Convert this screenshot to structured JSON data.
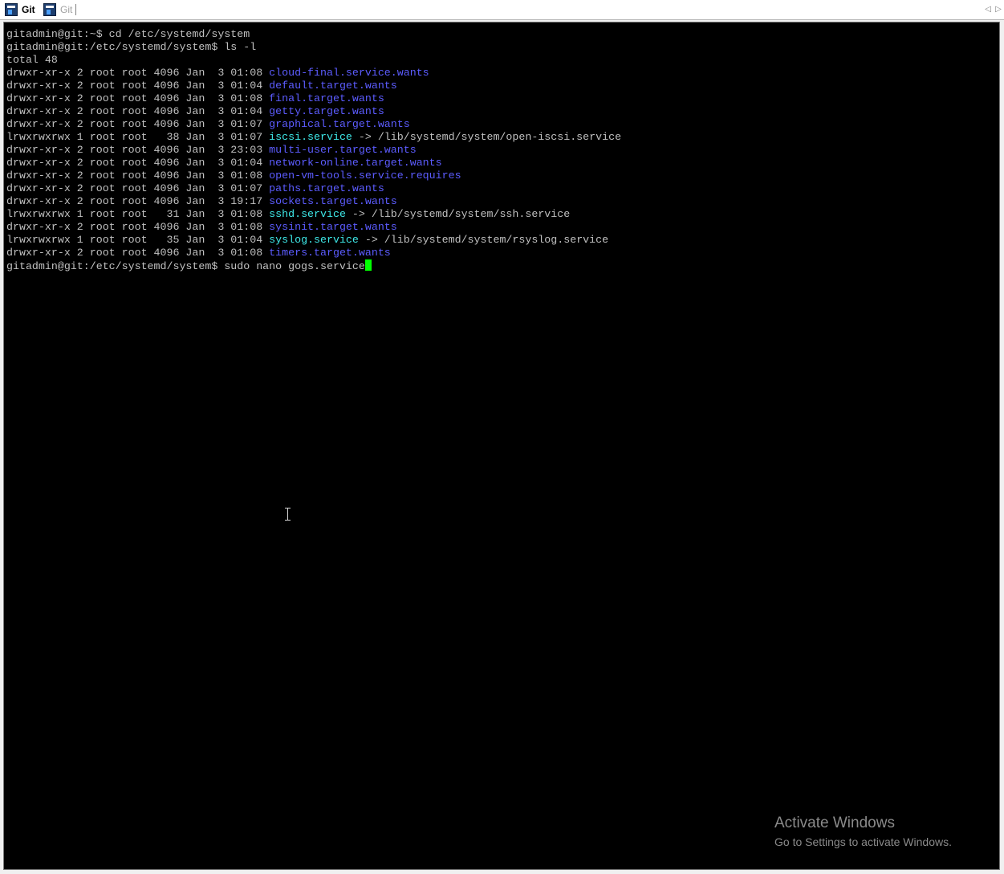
{
  "tabs": [
    {
      "label": "Git",
      "active": true
    },
    {
      "label": "Git",
      "active": false
    }
  ],
  "terminal": {
    "lines": [
      [
        {
          "t": "gitadmin@git:~$ cd /etc/systemd/system",
          "c": "plain"
        }
      ],
      [
        {
          "t": "gitadmin@git:/etc/systemd/system$ ls -l",
          "c": "plain"
        }
      ],
      [
        {
          "t": "total 48",
          "c": "plain"
        }
      ],
      [
        {
          "t": "drwxr-xr-x 2 root root 4096 Jan  3 01:08 ",
          "c": "plain"
        },
        {
          "t": "cloud-final.service.wants",
          "c": "dir"
        }
      ],
      [
        {
          "t": "drwxr-xr-x 2 root root 4096 Jan  3 01:04 ",
          "c": "plain"
        },
        {
          "t": "default.target.wants",
          "c": "dir"
        }
      ],
      [
        {
          "t": "drwxr-xr-x 2 root root 4096 Jan  3 01:08 ",
          "c": "plain"
        },
        {
          "t": "final.target.wants",
          "c": "dir"
        }
      ],
      [
        {
          "t": "drwxr-xr-x 2 root root 4096 Jan  3 01:04 ",
          "c": "plain"
        },
        {
          "t": "getty.target.wants",
          "c": "dir"
        }
      ],
      [
        {
          "t": "drwxr-xr-x 2 root root 4096 Jan  3 01:07 ",
          "c": "plain"
        },
        {
          "t": "graphical.target.wants",
          "c": "dir"
        }
      ],
      [
        {
          "t": "lrwxrwxrwx 1 root root   38 Jan  3 01:07 ",
          "c": "plain"
        },
        {
          "t": "iscsi.service",
          "c": "lnk"
        },
        {
          "t": " -> /lib/systemd/system/open-iscsi.service",
          "c": "plain"
        }
      ],
      [
        {
          "t": "drwxr-xr-x 2 root root 4096 Jan  3 23:03 ",
          "c": "plain"
        },
        {
          "t": "multi-user.target.wants",
          "c": "dir"
        }
      ],
      [
        {
          "t": "drwxr-xr-x 2 root root 4096 Jan  3 01:04 ",
          "c": "plain"
        },
        {
          "t": "network-online.target.wants",
          "c": "dir"
        }
      ],
      [
        {
          "t": "drwxr-xr-x 2 root root 4096 Jan  3 01:08 ",
          "c": "plain"
        },
        {
          "t": "open-vm-tools.service.requires",
          "c": "dir"
        }
      ],
      [
        {
          "t": "drwxr-xr-x 2 root root 4096 Jan  3 01:07 ",
          "c": "plain"
        },
        {
          "t": "paths.target.wants",
          "c": "dir"
        }
      ],
      [
        {
          "t": "drwxr-xr-x 2 root root 4096 Jan  3 19:17 ",
          "c": "plain"
        },
        {
          "t": "sockets.target.wants",
          "c": "dir"
        }
      ],
      [
        {
          "t": "lrwxrwxrwx 1 root root   31 Jan  3 01:08 ",
          "c": "plain"
        },
        {
          "t": "sshd.service",
          "c": "lnk"
        },
        {
          "t": " -> /lib/systemd/system/ssh.service",
          "c": "plain"
        }
      ],
      [
        {
          "t": "drwxr-xr-x 2 root root 4096 Jan  3 01:08 ",
          "c": "plain"
        },
        {
          "t": "sysinit.target.wants",
          "c": "dir"
        }
      ],
      [
        {
          "t": "lrwxrwxrwx 1 root root   35 Jan  3 01:04 ",
          "c": "plain"
        },
        {
          "t": "syslog.service",
          "c": "lnk"
        },
        {
          "t": " -> /lib/systemd/system/rsyslog.service",
          "c": "plain"
        }
      ],
      [
        {
          "t": "drwxr-xr-x 2 root root 4096 Jan  3 01:08 ",
          "c": "plain"
        },
        {
          "t": "timers.target.wants",
          "c": "dir"
        }
      ],
      [
        {
          "t": "gitadmin@git:/etc/systemd/system$ sudo nano gogs.service",
          "c": "plain"
        }
      ]
    ]
  },
  "watermark": {
    "title": "Activate Windows",
    "subtitle": "Go to Settings to activate Windows."
  },
  "colors": {
    "background": "#000000",
    "text": "#c0c0c0",
    "directory": "#5c5cff",
    "symlink": "#3ee8e8",
    "cursor": "#00ff00"
  }
}
